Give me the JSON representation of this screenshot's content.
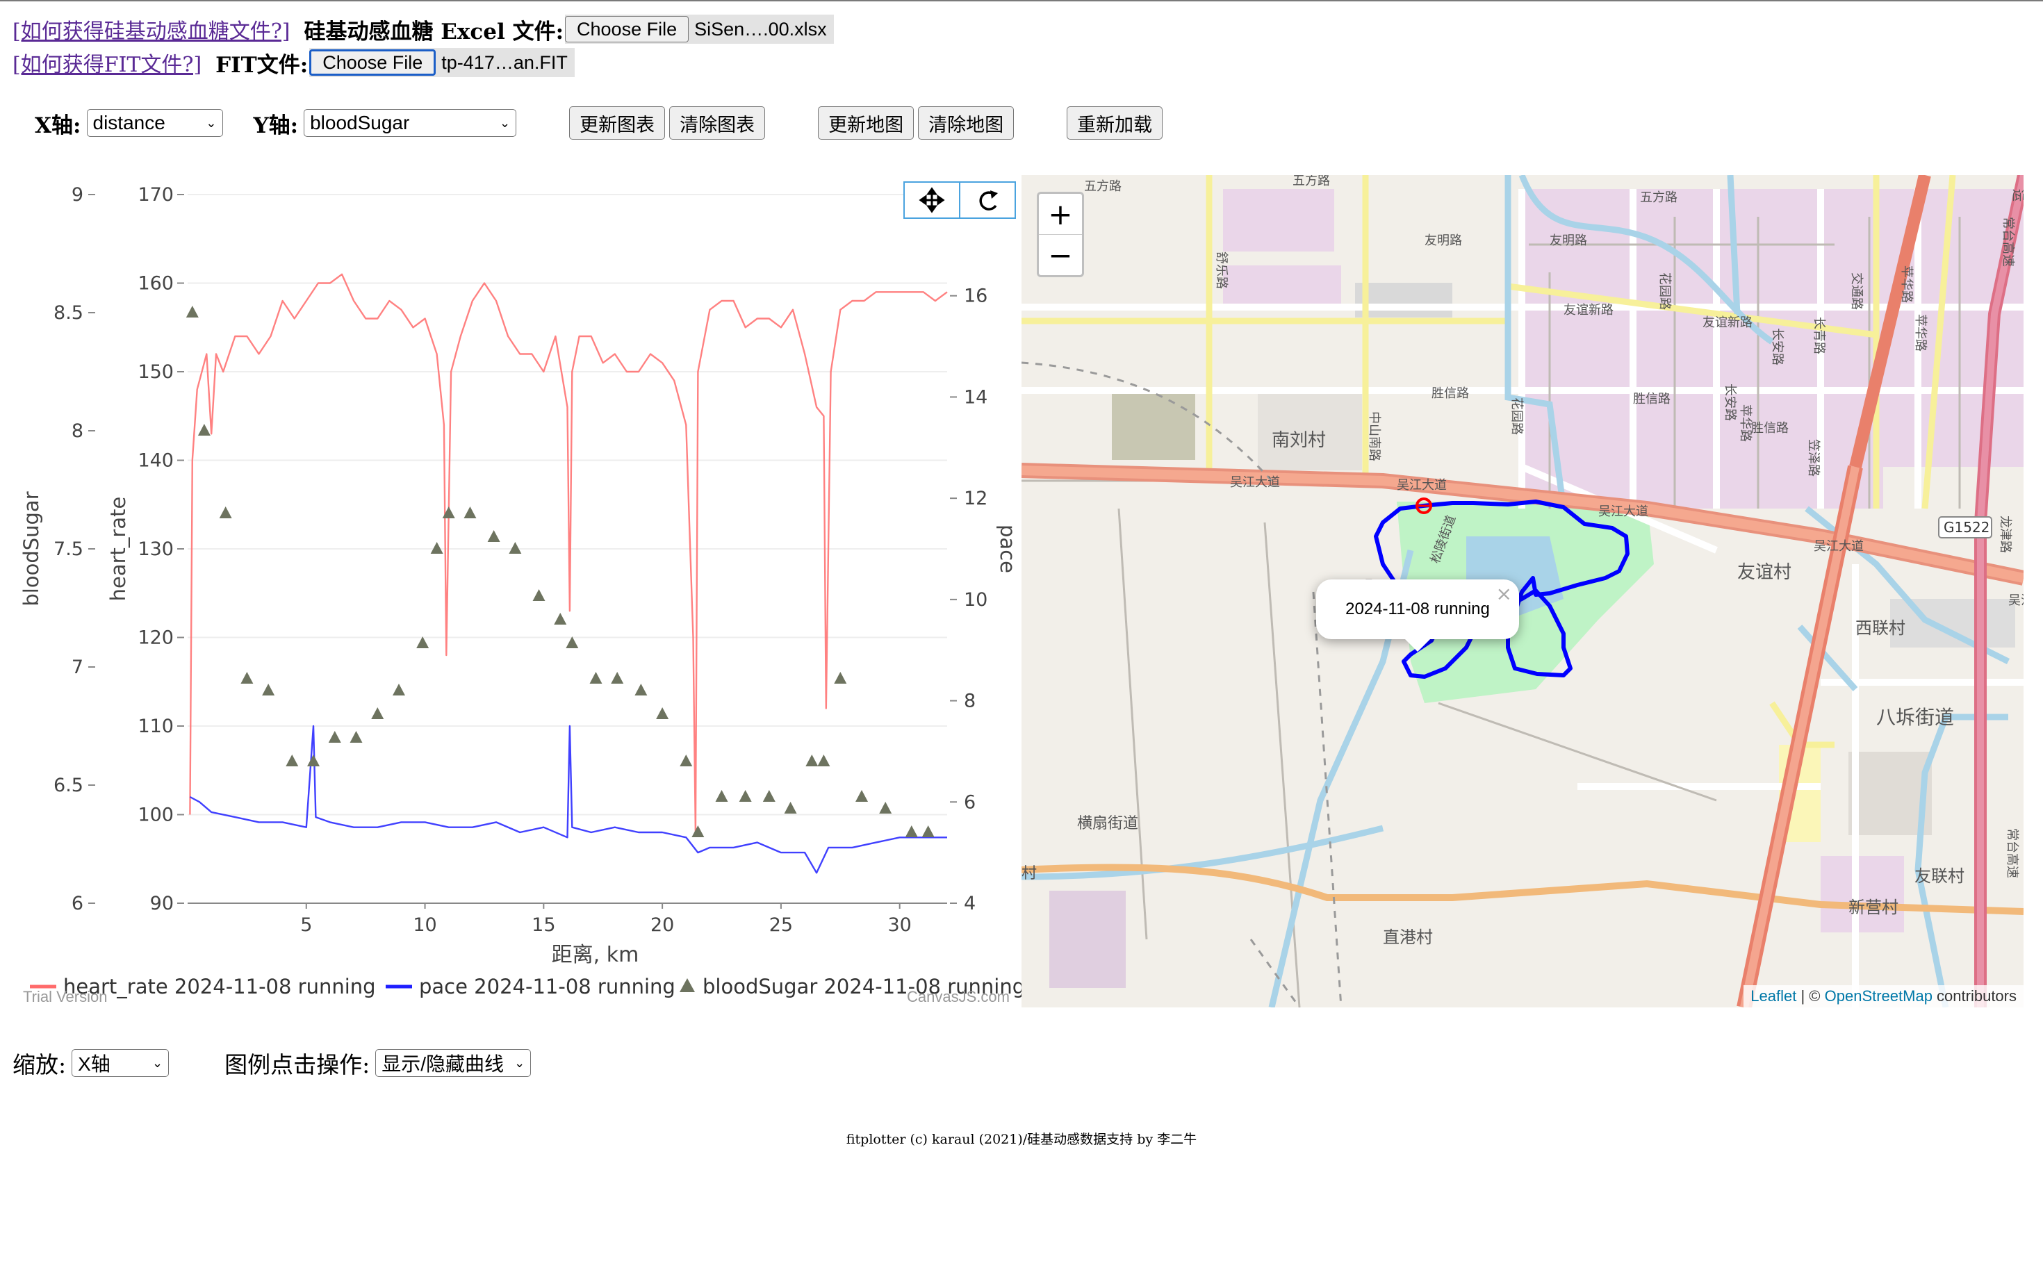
{
  "header": {
    "glucose_link": "[如何获得硅基动感血糖文件?]",
    "glucose_label": "硅基动感血糖 Excel 文件:",
    "glucose_button": "Choose File",
    "glucose_file": "SiSen….00.xlsx",
    "fit_link": "[如何获得FIT文件?]",
    "fit_label": "FIT文件:",
    "fit_button": "Choose File",
    "fit_file": "tp-417…an.FIT"
  },
  "controls": {
    "x_axis_label": "X轴:",
    "x_axis_value": "distance",
    "y_axis_label": "Y轴:",
    "y_axis_value": "bloodSugar",
    "update_chart": "更新图表",
    "clear_chart": "清除图表",
    "update_map": "更新地图",
    "clear_map": "清除地图",
    "reload": "重新加载"
  },
  "chart_toolbar": {
    "pan_icon": "pan-icon",
    "reset_icon": "reset-icon"
  },
  "chart_data": {
    "type": "line",
    "xlabel": "距离, km",
    "x_ticks": [
      5,
      10,
      15,
      20,
      25,
      30
    ],
    "x_range": [
      0,
      32
    ],
    "axes": {
      "bloodSugar": {
        "label": "bloodSugar",
        "range": [
          6,
          9
        ],
        "ticks": [
          "6",
          "6.5",
          "7",
          "7.5",
          "8",
          "8.5",
          "9"
        ]
      },
      "heart_rate": {
        "label": "heart_rate",
        "range": [
          90,
          170
        ],
        "ticks": [
          "90",
          "100",
          "110",
          "120",
          "130",
          "140",
          "150",
          "160",
          "170"
        ]
      },
      "pace": {
        "label": "pace",
        "range": [
          4,
          18
        ],
        "ticks": [
          "4",
          "6",
          "8",
          "10",
          "12",
          "14",
          "16"
        ]
      }
    },
    "series": [
      {
        "name": "heart_rate 2024-11-08 running",
        "axis": "heart_rate",
        "color": "#ff6b6b",
        "x": [
          0.1,
          0.2,
          0.4,
          0.6,
          0.8,
          1.0,
          1.2,
          1.5,
          2,
          2.5,
          3,
          3.5,
          4,
          4.5,
          5,
          5.5,
          6,
          6.5,
          7,
          7.5,
          8,
          8.5,
          9,
          9.5,
          10,
          10.5,
          10.8,
          10.9,
          11.1,
          11.5,
          12,
          12.5,
          13,
          13.5,
          14,
          14.5,
          15,
          15.5,
          16,
          16.1,
          16.2,
          16.5,
          17,
          17.5,
          18,
          18.5,
          19,
          19.5,
          20,
          20.5,
          21,
          21.3,
          21.4,
          21.5,
          22,
          22.5,
          23,
          23.5,
          24,
          24.5,
          25,
          25.5,
          26,
          26.5,
          26.8,
          26.9,
          27.1,
          27.5,
          28,
          28.5,
          29,
          29.5,
          30,
          30.5,
          31,
          31.5,
          32
        ],
        "values": [
          100,
          140,
          148,
          150,
          152,
          143,
          152,
          150,
          154,
          154,
          152,
          154,
          158,
          156,
          158,
          160,
          160,
          161,
          158,
          156,
          156,
          158,
          157,
          155,
          156,
          152,
          144,
          118,
          150,
          154,
          158,
          160,
          158,
          154,
          152,
          152,
          150,
          154,
          146,
          123,
          150,
          154,
          154,
          151,
          152,
          150,
          150,
          152,
          151,
          149,
          144,
          120,
          98,
          150,
          157,
          158,
          158,
          155,
          156,
          156,
          155,
          157,
          152,
          146,
          145,
          112,
          150,
          157,
          158,
          158,
          159,
          159,
          159,
          159,
          159,
          158,
          159
        ]
      },
      {
        "name": "pace 2024-11-08 running",
        "axis": "pace",
        "color": "#1f1fff",
        "x": [
          0.1,
          0.5,
          1,
          2,
          3,
          4,
          5,
          5.3,
          5.4,
          6,
          7,
          8,
          9,
          10,
          11,
          12,
          13,
          14,
          15,
          16,
          16.1,
          16.2,
          17,
          18,
          19,
          20,
          21,
          21.5,
          22,
          23,
          24,
          25,
          26,
          26.5,
          27,
          28,
          29,
          30,
          31,
          32
        ],
        "values": [
          6.1,
          6.0,
          5.8,
          5.7,
          5.6,
          5.6,
          5.5,
          7.5,
          5.7,
          5.6,
          5.5,
          5.5,
          5.6,
          5.6,
          5.5,
          5.5,
          5.6,
          5.4,
          5.5,
          5.3,
          7.5,
          5.5,
          5.4,
          5.5,
          5.4,
          5.4,
          5.3,
          5.0,
          5.1,
          5.1,
          5.2,
          5.0,
          5.0,
          4.6,
          5.1,
          5.1,
          5.2,
          5.3,
          5.3,
          5.3
        ]
      },
      {
        "name": "bloodSugar 2024-11-08 running",
        "axis": "bloodSugar",
        "color": "#6d735f",
        "marker": "triangle",
        "x": [
          0.2,
          0.7,
          1.6,
          2.5,
          3.4,
          4.4,
          5.3,
          6.2,
          7.1,
          8.0,
          8.9,
          9.9,
          10.5,
          11.0,
          11.9,
          12.9,
          13.8,
          14.8,
          15.7,
          16.2,
          17.2,
          18.1,
          19.1,
          20.0,
          21.0,
          21.5,
          22.5,
          23.5,
          24.5,
          25.4,
          26.3,
          26.8,
          27.5,
          28.4,
          29.4,
          30.5,
          31.2
        ],
        "values": [
          8.5,
          8.0,
          7.65,
          6.95,
          6.9,
          6.6,
          6.6,
          6.7,
          6.7,
          6.8,
          6.9,
          7.1,
          7.5,
          7.65,
          7.65,
          7.55,
          7.5,
          7.3,
          7.2,
          7.1,
          6.95,
          6.95,
          6.9,
          6.8,
          6.6,
          6.3,
          6.45,
          6.45,
          6.45,
          6.4,
          6.6,
          6.6,
          6.95,
          6.45,
          6.4,
          6.3,
          6.3
        ]
      }
    ],
    "legend_position": "bottom",
    "grid": true
  },
  "chart_watermark": {
    "left": "Trial Version",
    "right": "CanvasJS.com"
  },
  "map": {
    "zoom_in": "+",
    "zoom_out": "−",
    "popup_text": "2024-11-08 running",
    "popup_close": "×",
    "attribution_leaflet": "Leaflet",
    "attribution_sep": " | © ",
    "attribution_osm": "OpenStreetMap",
    "attribution_tail": " contributors",
    "labels": [
      {
        "text": "五方路",
        "name": "map-label-wufang-1"
      },
      {
        "text": "五方路",
        "name": "map-label-wufang-2"
      },
      {
        "text": "五方路",
        "name": "map-label-wufang-3"
      },
      {
        "text": "友明路",
        "name": "map-label-youming-1"
      },
      {
        "text": "友明路",
        "name": "map-label-youming-2"
      },
      {
        "text": "友谊新路",
        "name": "map-label-youyixin-1"
      },
      {
        "text": "友谊新路",
        "name": "map-label-youyixin-2"
      },
      {
        "text": "胜信路",
        "name": "map-label-shengxin-1"
      },
      {
        "text": "胜信路",
        "name": "map-label-shengxin-2"
      },
      {
        "text": "胜信路",
        "name": "map-label-shengxin-3"
      },
      {
        "text": "南刘村",
        "name": "map-label-nanliu"
      },
      {
        "text": "吴江大道",
        "name": "map-label-wujiang-1"
      },
      {
        "text": "吴江大道",
        "name": "map-label-wujiang-2"
      },
      {
        "text": "吴江大道",
        "name": "map-label-wujiang-3"
      },
      {
        "text": "吴江大道",
        "name": "map-label-wujiang-4"
      },
      {
        "text": "友谊村",
        "name": "map-label-youyicun"
      },
      {
        "text": "西联村",
        "name": "map-label-xilian"
      },
      {
        "text": "八坼街道",
        "name": "map-label-bache"
      },
      {
        "text": "横扇街道",
        "name": "map-label-hengshan"
      },
      {
        "text": "直港村",
        "name": "map-label-zhigang"
      },
      {
        "text": "新营村",
        "name": "map-label-xinying"
      },
      {
        "text": "友联村",
        "name": "map-label-youlian"
      },
      {
        "text": "G1522",
        "name": "map-label-g1522"
      },
      {
        "text": "松陵街道",
        "name": "map-label-songling"
      },
      {
        "text": "中山南路",
        "name": "map-label-zhongshan-1"
      },
      {
        "text": "中山南路",
        "name": "map-label-zhongshan-2"
      },
      {
        "text": "花园路",
        "name": "map-label-huayuan-1"
      },
      {
        "text": "花园路",
        "name": "map-label-huayuan-2"
      },
      {
        "text": "长安路",
        "name": "map-label-changan-1"
      },
      {
        "text": "长安路",
        "name": "map-label-changan-2"
      },
      {
        "text": "长青路",
        "name": "map-label-changqing"
      },
      {
        "text": "苹华路",
        "name": "map-label-pinghua-1"
      },
      {
        "text": "苹华路",
        "name": "map-label-pinghua-2"
      },
      {
        "text": "苹华路",
        "name": "map-label-pinghua-3"
      },
      {
        "text": "交通路",
        "name": "map-label-jiaotong"
      },
      {
        "text": "常台高速",
        "name": "map-label-changtai-1"
      },
      {
        "text": "常台高速",
        "name": "map-label-changtai-2"
      },
      {
        "text": "笠泽路",
        "name": "map-label-lize"
      },
      {
        "text": "舒乐路",
        "name": "map-label-shule"
      },
      {
        "text": "龙津路",
        "name": "map-label-longjin"
      },
      {
        "text": "运",
        "name": "map-label-yun"
      },
      {
        "text": "村",
        "name": "map-label-cun"
      },
      {
        "text": "吴江",
        "name": "map-label-wujiang-edge"
      }
    ]
  },
  "bottom": {
    "zoom_label": "缩放:",
    "zoom_value": "X轴",
    "legend_label": "图例点击操作:",
    "legend_value": "显示/隐藏曲线"
  },
  "footer": "fitplotter (c) karaul (2021)/硅基动感数据支持 by 李二牛",
  "colors": {
    "link": "#5a2a95",
    "route": "#0000ff",
    "heart_rate": "#ff6b6b",
    "pace": "#1f1fff",
    "bloodSugar": "#6d735f"
  }
}
